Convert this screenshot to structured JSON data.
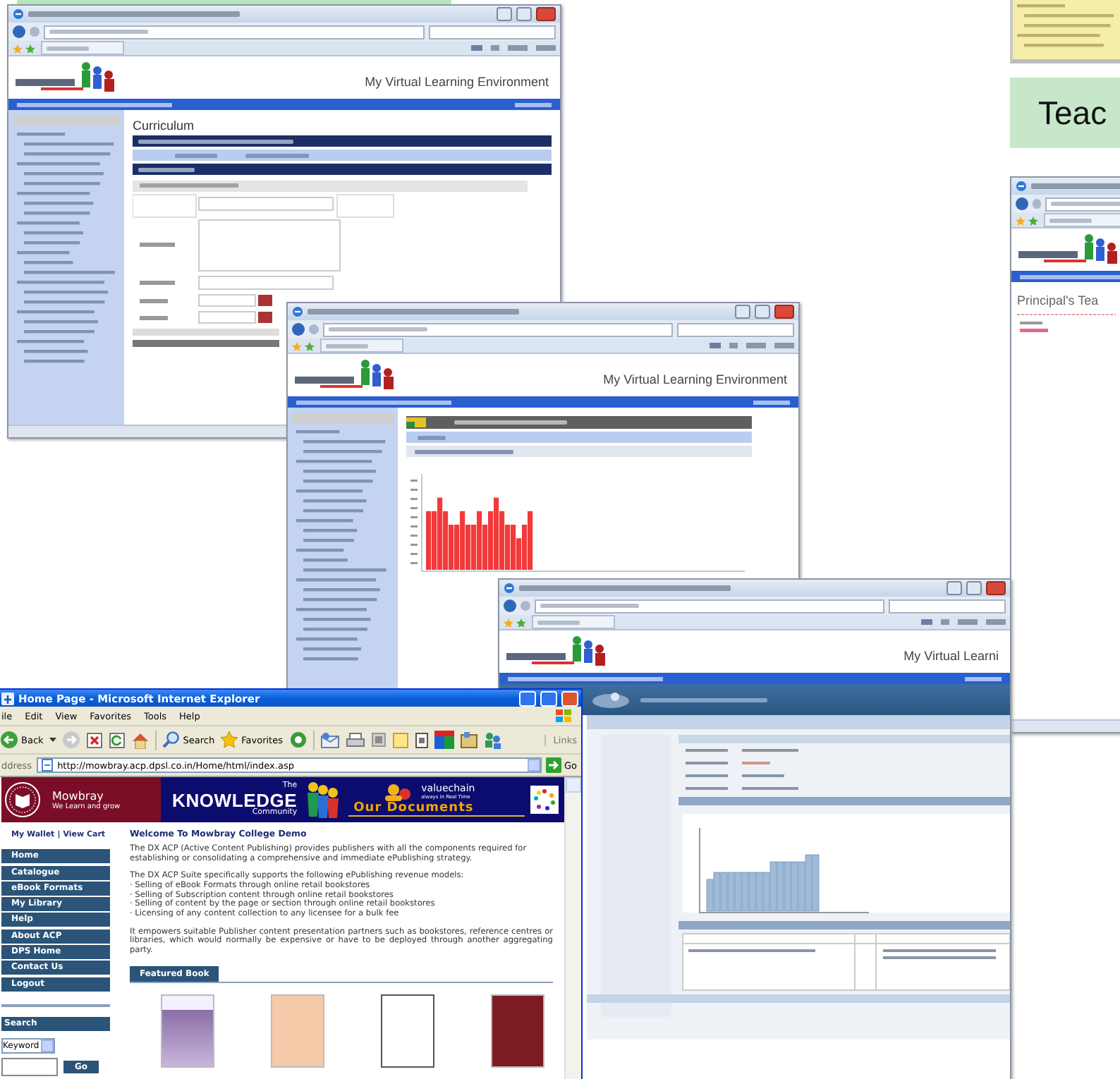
{
  "teacher_banner": {
    "label": "Teac"
  },
  "curriculum_window": {
    "header_title": "My Virtual Learning Environment",
    "heading": "Curriculum"
  },
  "report_window": {
    "header_title": "My Virtual Learning Environment"
  },
  "dashboard_window": {
    "header_title": "My Virtual Learni"
  },
  "principal_window": {
    "heading": "Principal's Tea"
  },
  "ie_window": {
    "title": "Home Page - Microsoft Internet Explorer",
    "menu": [
      "ile",
      "Edit",
      "View",
      "Favorites",
      "Tools",
      "Help"
    ],
    "toolbar": {
      "back": "Back",
      "search": "Search",
      "favorites": "Favorites",
      "links": "Links"
    },
    "address": {
      "label": "ddress",
      "url": "http://mowbray.acp.dpsl.co.in/Home/html/index.asp",
      "go": "Go"
    },
    "banner": {
      "school": "Mowbray",
      "motto": "We Learn and grow",
      "the": "The",
      "brand": "KNOWLEDGE",
      "community": "Community",
      "partner": "valuechain",
      "partner_tagline": "always in Real Time",
      "section": "Our Documents"
    },
    "account_links": [
      "My Wallet",
      "View Cart"
    ],
    "account_separator": "|",
    "nav": [
      "Home",
      "Catalogue",
      "eBook Formats",
      "My Library",
      "Help",
      "About ACP",
      "DPS Home",
      "Contact Us",
      "Logout"
    ],
    "search": {
      "title": "Search",
      "field_type": "Keyword",
      "button": "Go"
    },
    "welcome": {
      "heading": "Welcome To Mowbray College Demo",
      "intro": "The DX ACP (Active Content Publishing) provides publishers with all the components required for establishing or consolidating a comprehensive and immediate ePublishing strategy.",
      "models_title": "The DX ACP Suite specifically supports the following ePublishing revenue models:",
      "models": [
        "· Selling of eBook Formats through online retail bookstores",
        "· Selling of Subscription content through online retail bookstores",
        "· Selling of content by the page or section through online retail bookstores",
        "· Licensing of any content collection to any licensee for a bulk fee"
      ],
      "closing": "It empowers suitable Publisher content presentation partners such as bookstores, reference centres or libraries, which would normally be expensive or have to be deployed through another aggregating party."
    },
    "featured": {
      "title": "Featured Book"
    }
  }
}
